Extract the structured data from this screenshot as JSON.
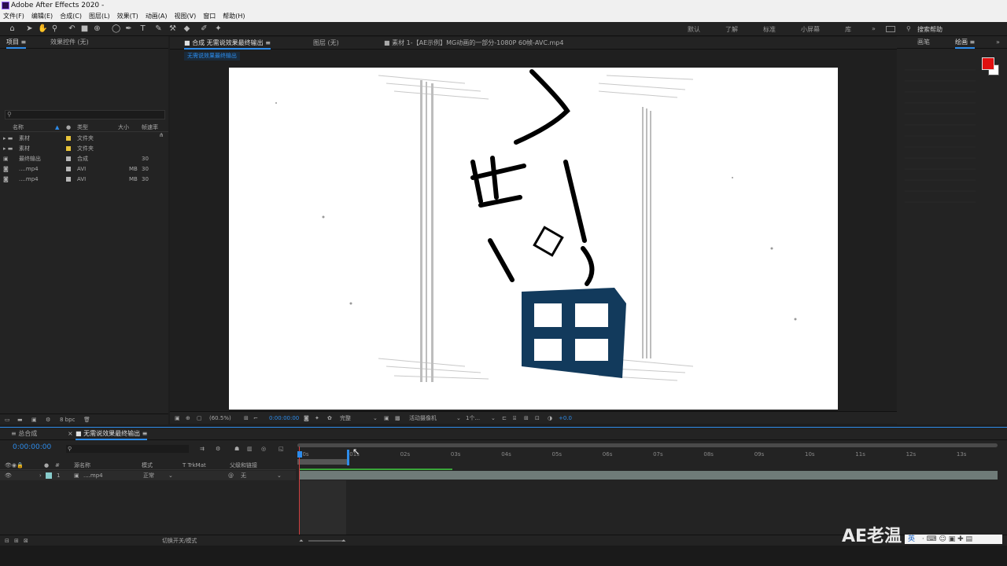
{
  "window": {
    "title": "Adobe After Effects 2020 -"
  },
  "menu": [
    "文件(F)",
    "编辑(E)",
    "合成(C)",
    "图层(L)",
    "效果(T)",
    "动画(A)",
    "视图(V)",
    "窗口",
    "帮助(H)"
  ],
  "workspaces": [
    "默认",
    "了解",
    "标准",
    "小屏幕",
    "库"
  ],
  "search_help": "搜索帮助",
  "project_panel": {
    "tabs": [
      "项目",
      "效果控件 (无)"
    ],
    "search_placeholder": "",
    "columns": [
      "名称",
      "类型",
      "大小",
      "帧速率"
    ],
    "items": [
      {
        "name": "素材",
        "type": "文件夹",
        "size": "",
        "fps": "",
        "color": "#e8c43a"
      },
      {
        "name": "素材",
        "type": "文件夹",
        "size": "",
        "fps": "",
        "color": "#e8c43a"
      },
      {
        "name": "最终输出",
        "type": "合成",
        "size": "",
        "fps": "30",
        "color": "#b7b7b7"
      },
      {
        "name": "....mp4",
        "type": "AVI",
        "size": "MB",
        "fps": "30",
        "color": "#b7b7b7"
      },
      {
        "name": "....mp4",
        "type": "AVI",
        "size": "MB",
        "fps": "30",
        "color": "#b7b7b7"
      }
    ],
    "bpc": "8 bpc"
  },
  "viewer": {
    "tabs": [
      "合成 无需说效果最终输出",
      "图层 (无)",
      "素材 1-【AE示例】MG动画的一部分-1080P 60帧-AVC.mp4"
    ],
    "breadcrumb": "无需说效果最终输出",
    "zoom": "(60.5%)",
    "time": "0:00:00:00",
    "quality": "完整",
    "camera": "活动摄像机",
    "views": "1个...",
    "exposure": "+0.0"
  },
  "right_panel": {
    "tabs": [
      "画笔",
      "绘画"
    ],
    "fg_color": "#e01010",
    "bg_color": "#ffffff"
  },
  "timeline": {
    "tabs": [
      "总合成",
      "无需说效果最终输出"
    ],
    "timecode": "0:00:00:00",
    "columns": [
      "源名称",
      "模式",
      "T TrkMat",
      "父级和链接"
    ],
    "layers": [
      {
        "num": "1",
        "name": "....mp4",
        "mode": "正常",
        "parent": "无"
      }
    ],
    "ruler": [
      "00s",
      "01s",
      "02s",
      "03s",
      "04s",
      "05s",
      "06s",
      "07s",
      "08s",
      "09s",
      "10s",
      "11s",
      "12s",
      "13s"
    ],
    "toggle_label": "切换开关/模式"
  },
  "watermark": "AE老温",
  "taskbar": {
    "ime": "英"
  }
}
